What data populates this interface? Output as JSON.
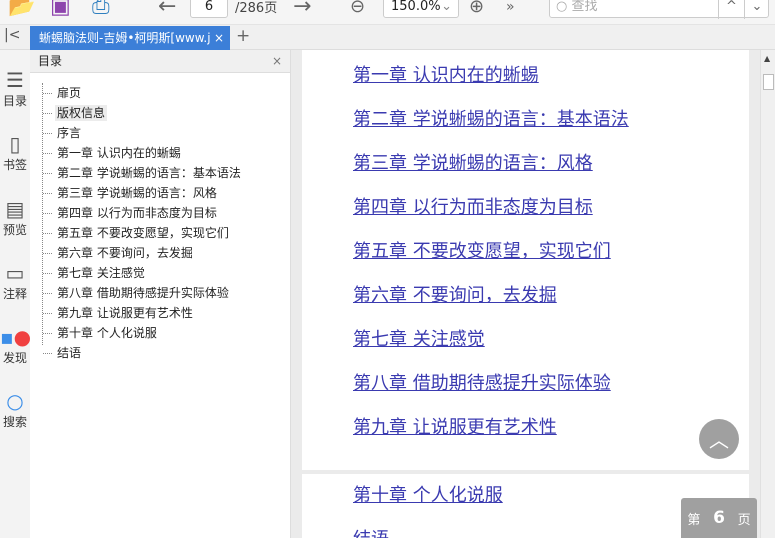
{
  "toolbar": {
    "page_current": "6",
    "page_total": "/286页",
    "zoom": "150.0%",
    "search_placeholder": "查找"
  },
  "tab": {
    "title": "蜥蜴脑法则-吉姆•柯明斯[www.j"
  },
  "rail": [
    {
      "label": "目录",
      "icon": "list-icon"
    },
    {
      "label": "书签",
      "icon": "bookmark-icon"
    },
    {
      "label": "预览",
      "icon": "preview-icon"
    },
    {
      "label": "注释",
      "icon": "note-icon"
    },
    {
      "label": "发现",
      "icon": "discover-icon"
    },
    {
      "label": "搜索",
      "icon": "search-icon"
    }
  ],
  "toc": {
    "title": "目录",
    "items": [
      "扉页",
      "版权信息",
      "序言",
      "第一章 认识内在的蜥蜴",
      "第二章 学说蜥蜴的语言：基本语法",
      "第三章 学说蜥蜴的语言：风格",
      "第四章 以行为而非态度为目标",
      "第五章 不要改变愿望，实现它们",
      "第六章 不要询问，去发掘",
      "第七章 关注感觉",
      "第八章 借助期待感提升实际体验",
      "第九章 让说服更有艺术性",
      "第十章 个人化说服",
      "结语"
    ]
  },
  "page1_links": [
    "第一章 认识内在的蜥蜴",
    "第二章 学说蜥蜴的语言：基本语法",
    "第三章 学说蜥蜴的语言：风格",
    "第四章 以行为而非态度为目标",
    "第五章 不要改变愿望，实现它们",
    "第六章 不要询问，去发掘",
    "第七章 关注感觉",
    "第八章 借助期待感提升实际体验",
    "第九章 让说服更有艺术性"
  ],
  "page2_links": [
    "第十章 个人化说服",
    "结语"
  ],
  "page_indicator": {
    "prefix": "第",
    "num": "6",
    "suffix": "页"
  }
}
